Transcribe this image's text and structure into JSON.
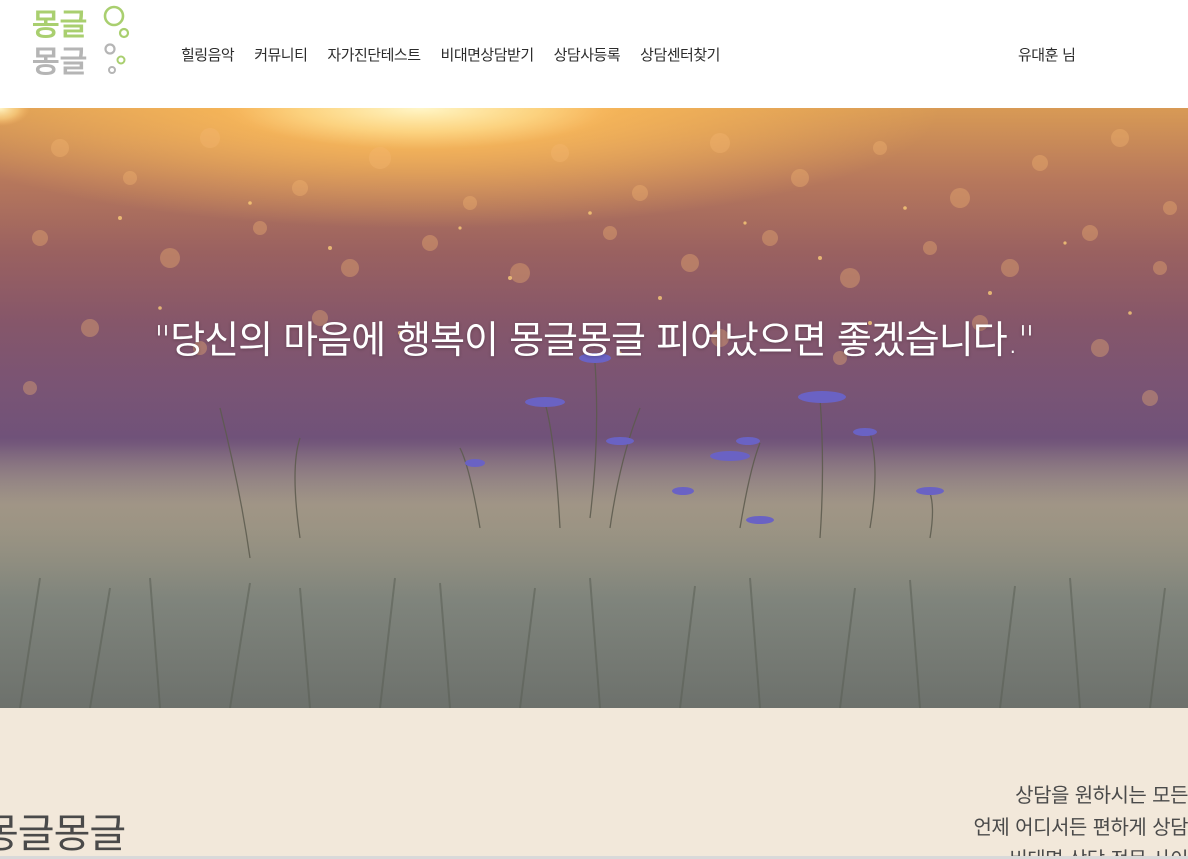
{
  "logo": {
    "line1": "몽글",
    "line2": "몽글",
    "colors": {
      "green": "#a9cf6f",
      "gray": "#b5b5b5"
    }
  },
  "nav": {
    "items": [
      {
        "label": "힐링음악"
      },
      {
        "label": "커뮤니티"
      },
      {
        "label": "자가진단테스트"
      },
      {
        "label": "비대면상담받기"
      },
      {
        "label": "상담사등록"
      },
      {
        "label": "상담센터찾기"
      }
    ]
  },
  "user": {
    "name": "유대훈 님"
  },
  "hero": {
    "quote": "\"당신의 마음에 행복이 몽글몽글 피어났으면 좋겠습니다.\""
  },
  "intro": {
    "brand": "몽글몽글",
    "lines": [
      "상담을 원하시는 모든",
      "언제 어디서든 편하게 상담",
      "비대면 상담 전문 사이"
    ],
    "background": "#f2e8da"
  }
}
